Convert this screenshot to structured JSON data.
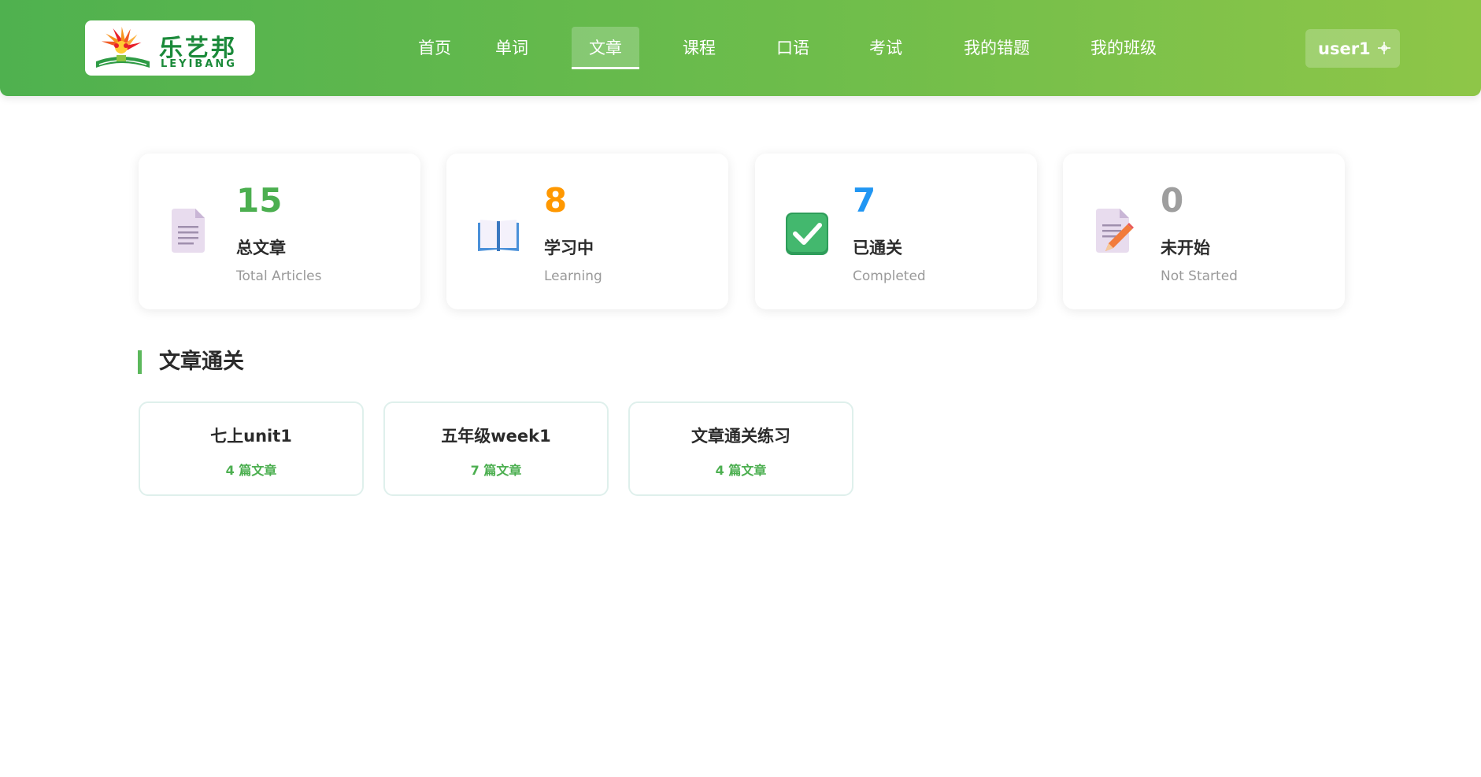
{
  "brand": {
    "name_cn": "乐艺邦",
    "name_en": "LEYIBANG",
    "colors": {
      "header_start": "#4fb14f",
      "header_end": "#8ec648",
      "accent_green": "#4caf50"
    }
  },
  "nav": {
    "items": [
      {
        "label": "首页",
        "active": false
      },
      {
        "label": "单词",
        "active": false
      },
      {
        "label": "文章",
        "active": true
      },
      {
        "label": "课程",
        "active": false
      },
      {
        "label": "口语",
        "active": false
      },
      {
        "label": "考试",
        "active": false
      },
      {
        "label": "我的错题",
        "active": false
      },
      {
        "label": "我的班级",
        "active": false
      }
    ]
  },
  "user": {
    "name": "user1",
    "icon": "logout-icon"
  },
  "stats": [
    {
      "value": "15",
      "label": "总文章",
      "sublabel": "Total Articles",
      "icon": "document-icon",
      "color": "#4caf50"
    },
    {
      "value": "8",
      "label": "学习中",
      "sublabel": "Learning",
      "icon": "open-book-icon",
      "color": "#ff9800"
    },
    {
      "value": "7",
      "label": "已通关",
      "sublabel": "Completed",
      "icon": "check-mark-icon",
      "color": "#2196f3"
    },
    {
      "value": "0",
      "label": "未开始",
      "sublabel": "Not Started",
      "icon": "document-pencil-icon",
      "color": "#9e9e9e"
    }
  ],
  "section": {
    "title": "文章通关"
  },
  "courses": [
    {
      "name": "七上unit1",
      "count": "4 篇文章"
    },
    {
      "name": "五年级week1",
      "count": "7 篇文章"
    },
    {
      "name": "文章通关练习",
      "count": "4 篇文章"
    }
  ]
}
